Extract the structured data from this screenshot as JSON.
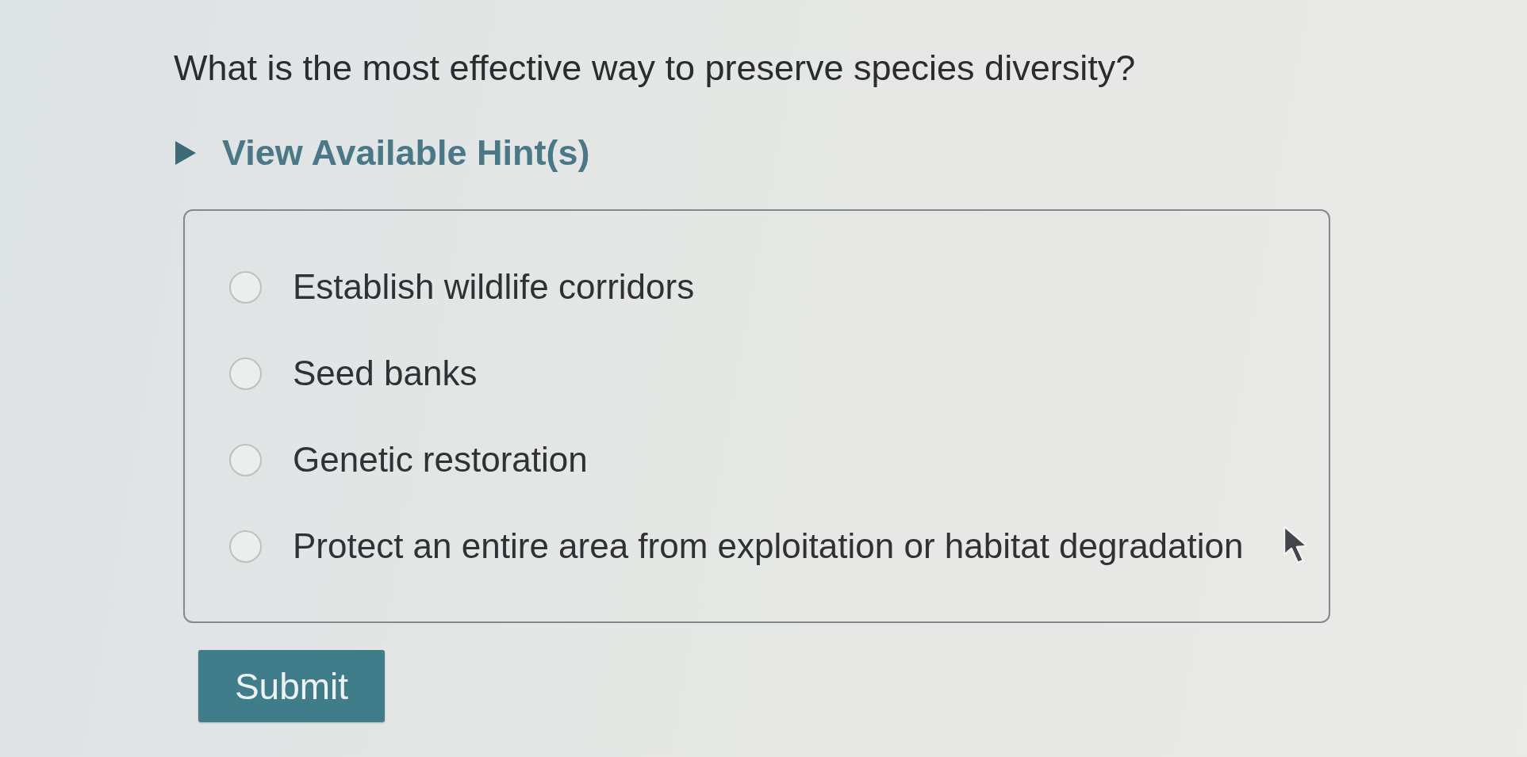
{
  "question": "What is the most effective way to preserve species diversity?",
  "hints": {
    "label": "View Available Hint(s)",
    "expanded": false
  },
  "options": [
    {
      "label": "Establish wildlife corridors",
      "selected": false
    },
    {
      "label": "Seed banks",
      "selected": false
    },
    {
      "label": "Genetic restoration",
      "selected": false
    },
    {
      "label": "Protect an entire area from exploitation or habitat degradation",
      "selected": false
    }
  ],
  "submit": {
    "label": "Submit"
  }
}
